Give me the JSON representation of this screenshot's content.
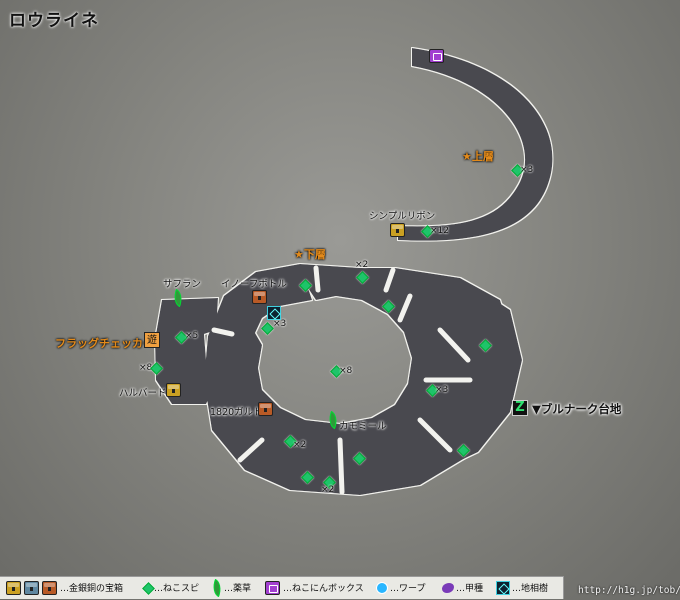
{
  "map": {
    "title": "ロウライネ",
    "floors": {
      "upper": "上層",
      "lower": "下層"
    },
    "exit_label": "▼ブルナーク台地",
    "items": {
      "simple_ribbon": "シンプルリボン",
      "saffron": "サフラン",
      "inofubottle": "イノーフボトル",
      "flag_checker": "フラッグチェッカー",
      "halberd": "ハルバード",
      "gald": "1820ガルド",
      "chamomile": "カモミール"
    },
    "counts": {
      "upper_right": "×3",
      "upper_bottom": "×12",
      "top_x2": "×2",
      "tree_x3": "×3",
      "left_x5": "×5",
      "left_x8": "×8",
      "center_x8": "×8",
      "right_x3": "×3",
      "bottom_x2a": "×2",
      "bottom_x2b": "×2"
    },
    "yuu_icon": "遊",
    "exit_icon": "Z"
  },
  "legend": {
    "chest": "…金銀銅の宝箱",
    "neko_spi": "…ねこスピ",
    "herb": "…薬草",
    "neko_box": "…ねこにんボックス",
    "warp": "…ワープ",
    "beetle": "…甲種",
    "tree": "…地相樹"
  },
  "credit": "http://h1g.jp/tob/",
  "colors": {
    "path": "#4a4950",
    "path_edge": "#f2f2ee",
    "background": "#8a8a86",
    "spi": "#1ec46a",
    "chest_gold": "#caa022",
    "chest_copper": "#b85a26",
    "chest_silver": "#5f87a0",
    "neko_box": "#a23fd0"
  }
}
